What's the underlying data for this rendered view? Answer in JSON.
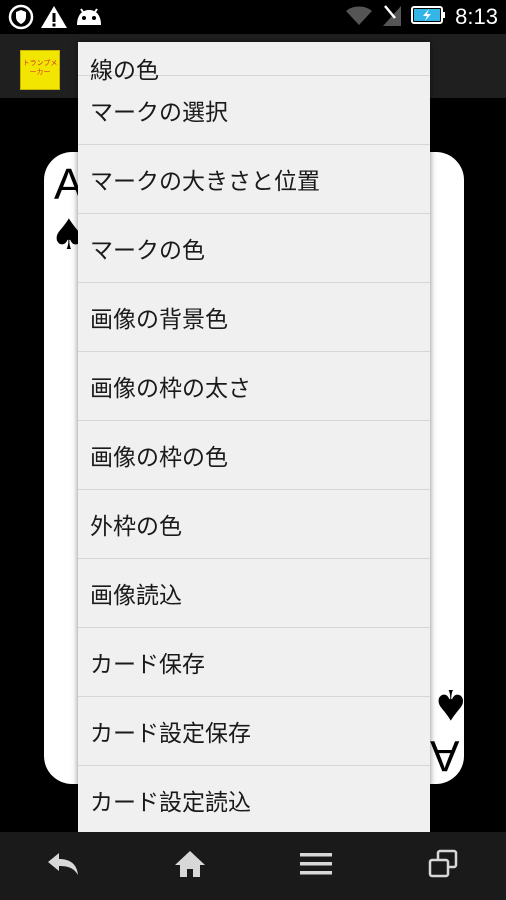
{
  "status_bar": {
    "time": "8:13",
    "icons": [
      "shield-notification-icon",
      "warning-icon",
      "android-icon",
      "wifi-icon",
      "no-signal-icon",
      "battery-charging-icon"
    ]
  },
  "app": {
    "logo_text": "トランプメーカー"
  },
  "card": {
    "rank": "A",
    "suit": "♠"
  },
  "menu": {
    "partial_label": "線の色",
    "items": [
      "マークの選択",
      "マークの大きさと位置",
      "マークの色",
      "画像の背景色",
      "画像の枠の太さ",
      "画像の枠の色",
      "外枠の色",
      "画像読込",
      "カード保存",
      "カード設定保存",
      "カード設定読込"
    ]
  },
  "nav": {
    "icons": [
      "back-icon",
      "home-icon",
      "menu-icon",
      "recent-apps-icon"
    ]
  }
}
